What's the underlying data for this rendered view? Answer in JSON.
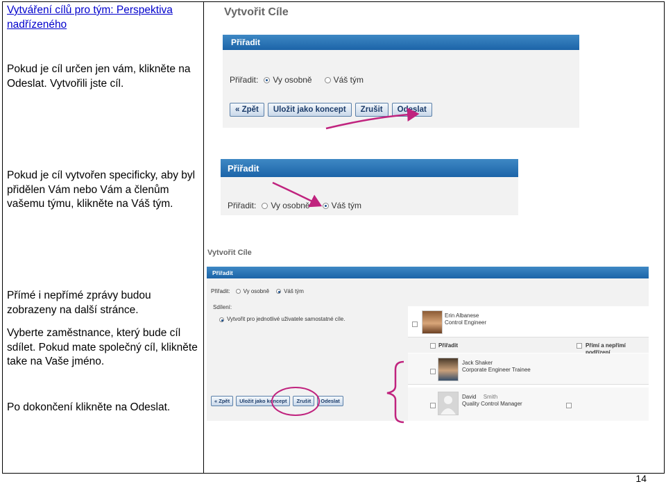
{
  "left": {
    "title": "Vytváření cílů pro tým: Perspektiva nadřízeného",
    "p1": "Pokud je cíl určen jen vám, klikněte na Odeslat.  Vytvořili jste cíl.",
    "p2": "Pokud je cíl vytvořen specificky, aby byl přidělen Vám nebo Vám a členům vašemu týmu, klikněte na Váš tým.",
    "p3": "Přímé i nepřímé zprávy budou zobrazeny na další stránce.",
    "p4": "Vyberte zaměstnance, který bude cíl sdílet. Pokud mate společný cíl, klikněte take na Vaše jméno.",
    "p5": "Po dokončení klikněte na Odeslat."
  },
  "shot1": {
    "heading": "Vytvořit Cíle",
    "bar": "Přiřadit",
    "assign_label": "Přiřadit:",
    "opt_personal": "Vy osobně",
    "opt_team": "Váš tým",
    "buttons": [
      "« Zpět",
      "Uložit jako koncept",
      "Zrušit",
      "Odeslat"
    ]
  },
  "shot2": {
    "bar": "Přiřadit",
    "assign_label": "Přiřadit:",
    "opt_personal": "Vy osobně",
    "opt_team": "Váš tým"
  },
  "shot3": {
    "heading": "Vytvořit Cíle",
    "bar": "Přiřadit",
    "assign_label": "Přiřadit:",
    "opt_personal": "Vy osobně",
    "opt_team": "Váš tým",
    "share_label": "Sdílení:",
    "share_option": "Vytvořit pro jednotlivé uživatele samostatné cíle.",
    "col_assign": "Přiřadit",
    "col_reports": "Přímí a nepřímí podřízení",
    "people": [
      {
        "name": "Erin Albanese",
        "role": "Control Engineer"
      },
      {
        "name": "Jack Shaker",
        "role": "Corporate Engineer Trainee"
      },
      {
        "name": "David",
        "surname": "Smith",
        "role": "Quality Control Manager"
      }
    ],
    "buttons": [
      "« Zpět",
      "Uložit jako koncept",
      "Zrušit",
      "Odeslat"
    ]
  },
  "page_number": "14",
  "colors": {
    "accent": "#1c64a8",
    "annotation": "#c0237e"
  }
}
